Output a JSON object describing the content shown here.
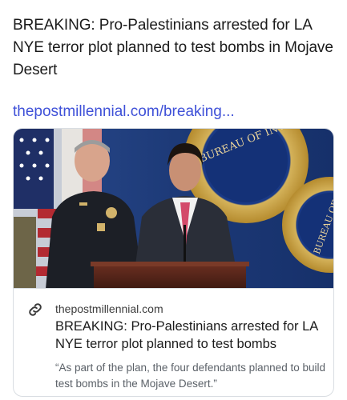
{
  "post": {
    "text": "BREAKING: Pro-Palestinians arrested for LA NYE terror plot planned to test bombs in Mojave Desert",
    "link_text": "thepostmillennial.com/breaking..."
  },
  "link_card": {
    "domain": "thepostmillennial.com",
    "title": "BREAKING: Pro-Palestinians arrested for LA NYE terror plot planned to test bombs",
    "description": "“As part of the plan, the four defendants planned to build test bombs in the Mojave Desert.”",
    "image": {
      "seal_text_top": "BUREAU OF INVESTIG",
      "seal_text_right": "BUREAU OF"
    },
    "icon": "link-icon"
  },
  "colors": {
    "link": "#3f51d8",
    "backdrop": "#1d3a78",
    "seal_gold": "#c9a040"
  }
}
